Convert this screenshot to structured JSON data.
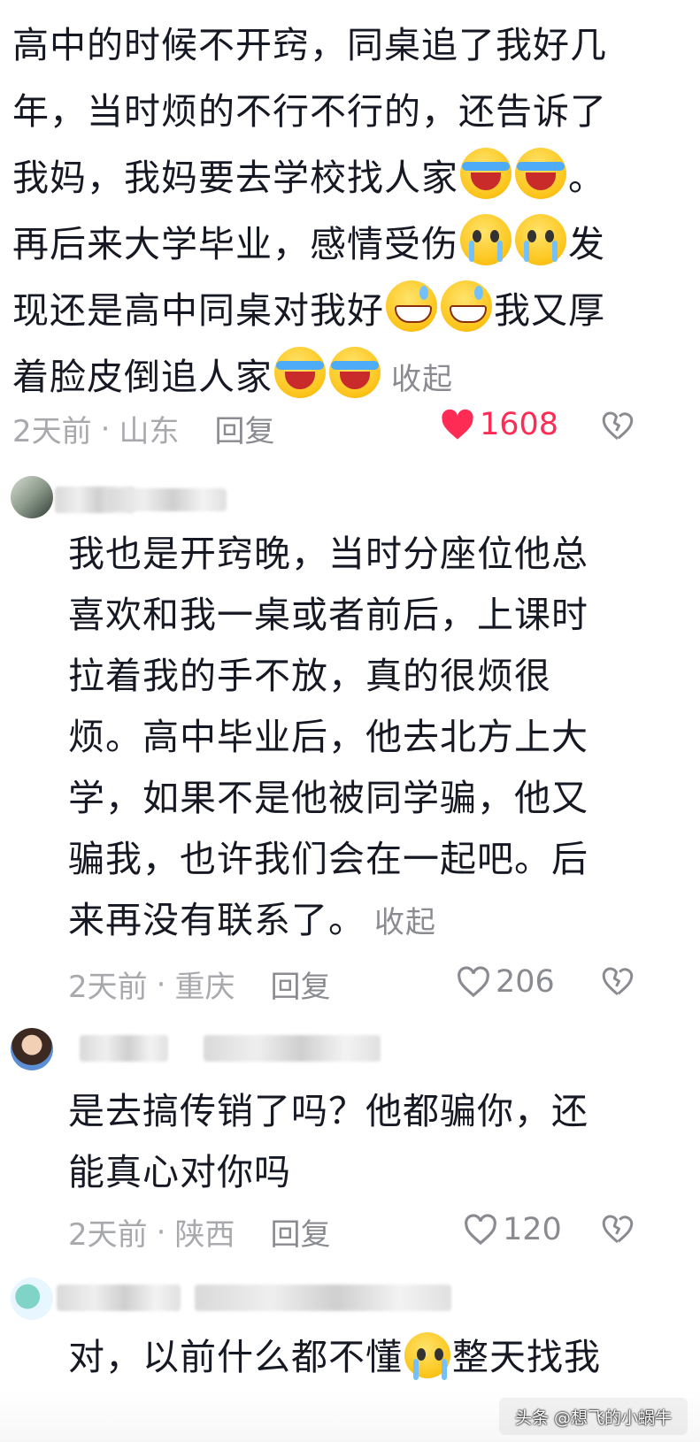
{
  "top_comment": {
    "line1": "高中的时候不开窍，同桌追了我好几",
    "line2": "年，当时烦的不行不行的，还告诉了",
    "line3": "我妈，我妈要去学校找人家",
    "line3_end": "。",
    "line4a": "再后来大学毕业，感情受伤",
    "line4b": "发",
    "line5a": "现还是高中同桌对我好",
    "line5b": "我又厚",
    "line6": "着脸皮倒追人家",
    "collapse": "收起",
    "time": "2天前",
    "location": "山东",
    "reply": "回复",
    "likes": "1608"
  },
  "reply1": {
    "lines": [
      "我也是开窍晚，当时分座位他总",
      "喜欢和我一桌或者前后，上课时",
      "拉着我的手不放，真的很烦很",
      "烦。高中毕业后，他去北方上大",
      "学，如果不是他被同学骗，他又",
      "骗我，也许我们会在一起吧。后",
      "来再没有联系了。"
    ],
    "collapse": "收起",
    "time": "2天前",
    "location": "重庆",
    "reply": "回复",
    "likes": "206"
  },
  "reply2": {
    "lines": [
      "是去搞传销了吗？他都骗你，还",
      "能真心对你吗"
    ],
    "time": "2天前",
    "location": "陕西",
    "reply": "回复",
    "likes": "120"
  },
  "reply3": {
    "partial_a": "对，以前什么都不懂",
    "partial_b": "整天找我"
  },
  "separator": "·",
  "watermark": "头条 @想飞的小蜗牛",
  "icons": {
    "heart": "heart-icon",
    "dislike": "broken-heart-icon",
    "emoji_cry": "crying-laughing-emoji",
    "emoji_sad": "pleading-tears-emoji",
    "emoji_grin": "grimacing-sweat-emoji"
  },
  "colors": {
    "liked": "#fe2c55",
    "meta": "#a8a9ad",
    "text": "#161823"
  }
}
